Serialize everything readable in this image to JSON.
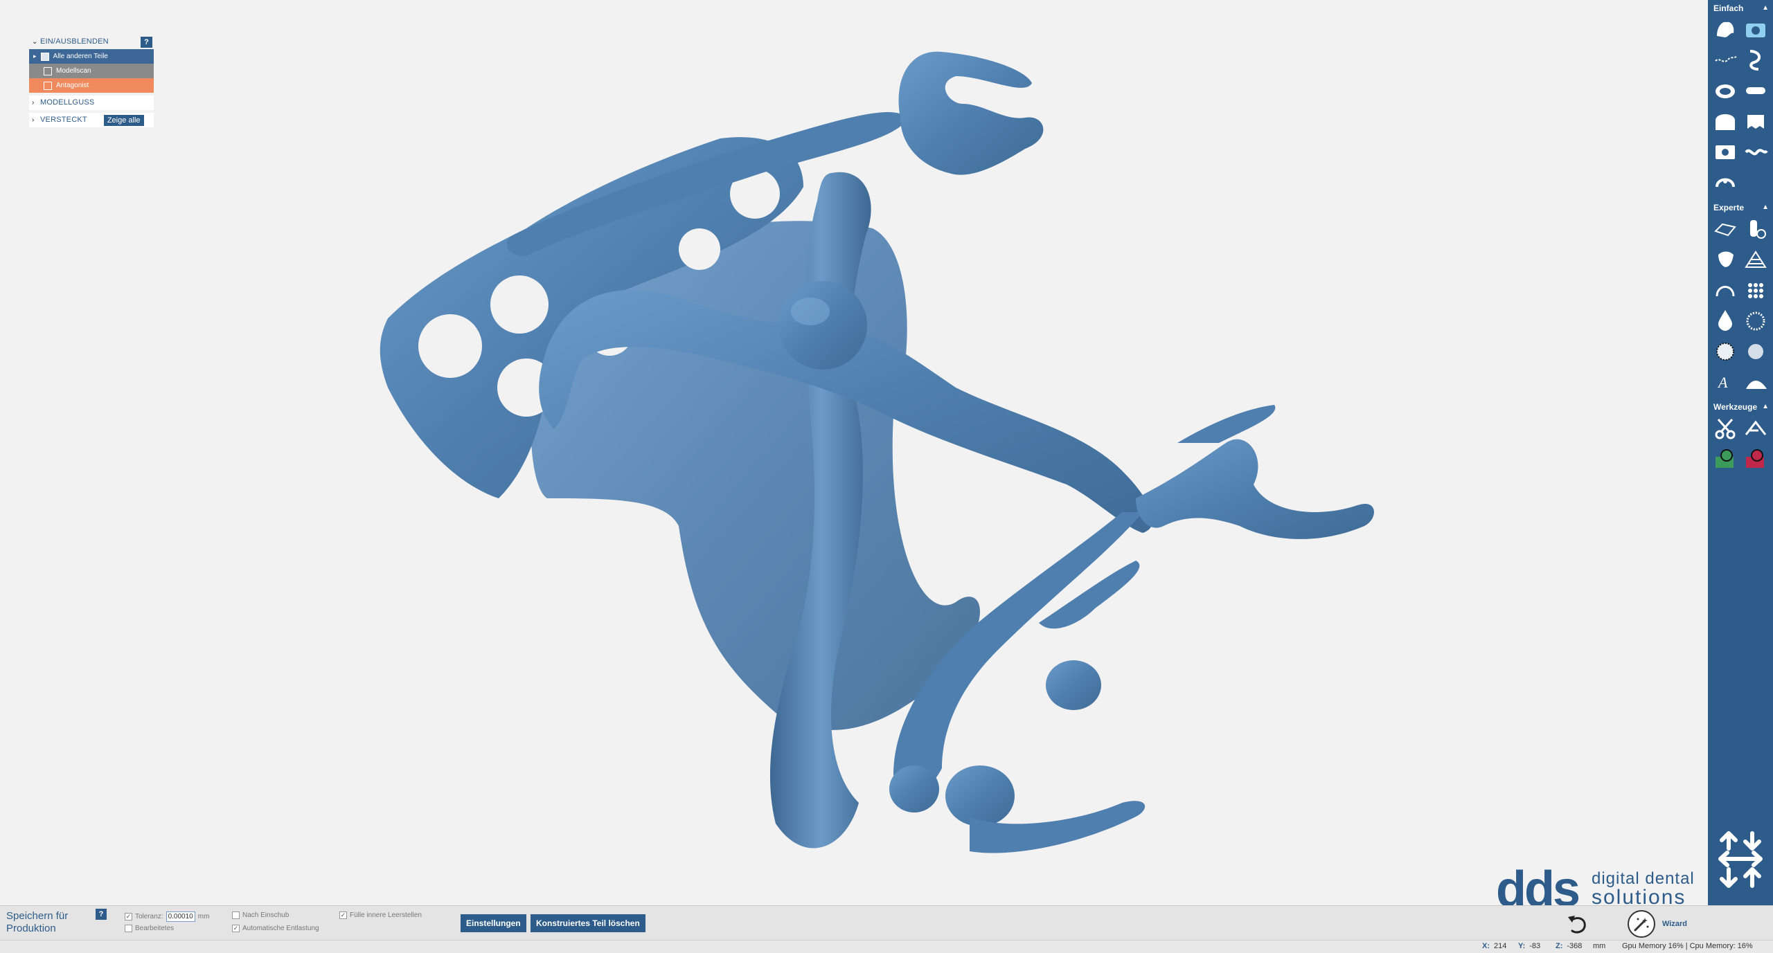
{
  "panel": {
    "header": "EIN/AUSBLENDEN",
    "help": "?",
    "items": [
      {
        "label": "Alle anderen Teile"
      },
      {
        "label": "Modellscan"
      },
      {
        "label": "Antagonist"
      }
    ],
    "modellguss": "MODELLGUSS",
    "versteckt": "VERSTECKT",
    "show_all": "Zeige alle"
  },
  "toolbar": {
    "sections": {
      "einfach": "Einfach",
      "experte": "Experte",
      "werkzeuge": "Werkzeuge"
    },
    "icons": {
      "einfach": [
        "tooth-clasp-icon",
        "camera-icon",
        "line-draw-icon",
        "hook-icon",
        "palate-icon",
        "retention-icon",
        "arch-icon",
        "teeth-icon",
        "scan-icon",
        "wave-icon",
        "jaw-icon"
      ],
      "experte": [
        "surface-icon",
        "bottle-add-icon",
        "tooth-icon",
        "mesh-icon",
        "arch-outline-icon",
        "dots-grid-icon",
        "drop-icon",
        "dotted-circle-icon",
        "dotted-sphere-icon",
        "sphere-icon",
        "text-icon",
        "wave-surface-icon"
      ],
      "werkzeuge": [
        "scissors-icon",
        "smooth-icon",
        "add-material-icon",
        "remove-material-icon"
      ]
    },
    "nav_icon": "move-arrows-icon"
  },
  "logo": {
    "letters": "dds",
    "line1": "digital dental",
    "line2": "solutions"
  },
  "bottom": {
    "save": "Speichern für Produktion",
    "help": "?",
    "toleranz_label": "Toleranz:",
    "toleranz_value": "0.00010",
    "toleranz_unit": "mm",
    "bearbeitetes": "Bearbeitetes",
    "nach_einschub": "Nach Einschub",
    "automatische": "Automatische Entlastung",
    "fuelle": "Fülle innere Leerstellen",
    "einstellungen": "Einstellungen",
    "loeschen": "Konstruiertes Teil löschen",
    "wizard": "Wizard"
  },
  "status": {
    "x_label": "X:",
    "x": "214",
    "y_label": "Y:",
    "y": "-83",
    "z_label": "Z:",
    "z": "-368",
    "unit": "mm",
    "memory": "Gpu Memory 16% | Cpu Memory: 16%"
  },
  "colors": {
    "accent": "#2e5c8a",
    "model": "#5b8ab8",
    "antagonist": "#f08a5d",
    "modellscan": "#8a8a8a"
  }
}
